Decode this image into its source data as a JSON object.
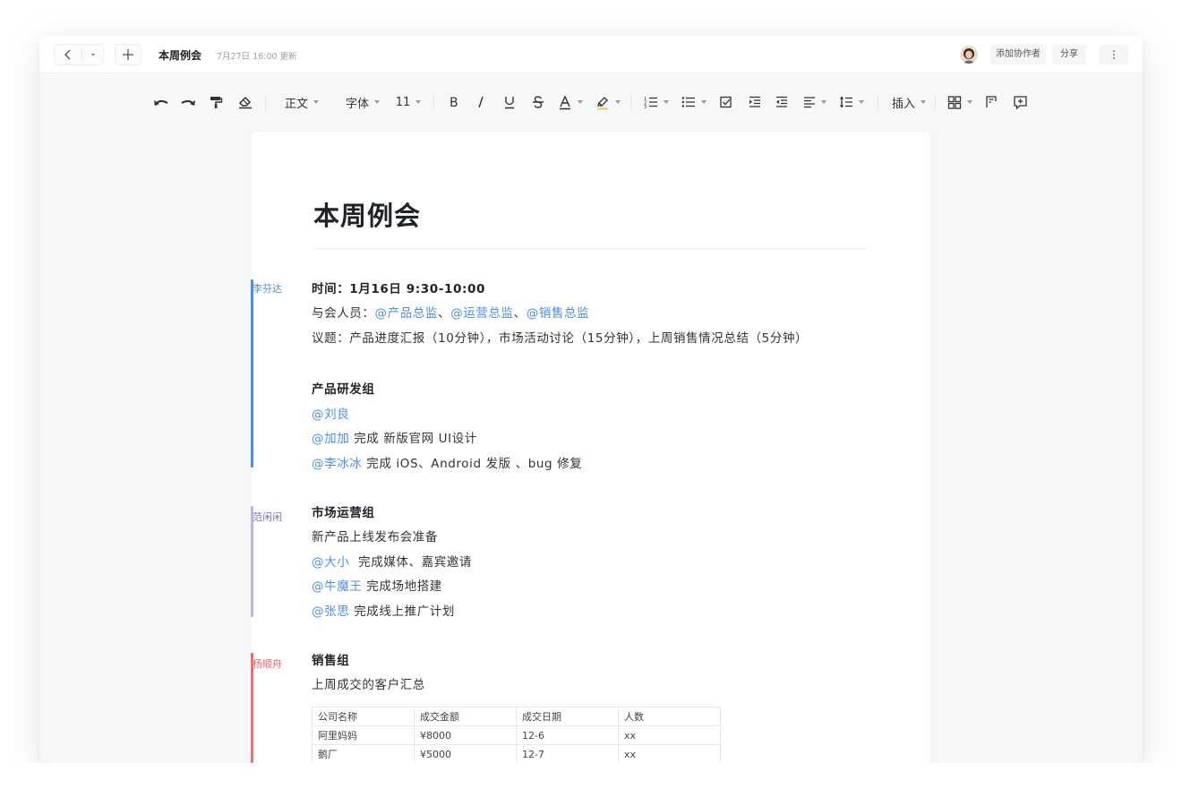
{
  "titlebar": {
    "doc_name": "本周例会",
    "update_time": "7月27日 16:00 更新",
    "add_collaborator": "添加协作者",
    "share": "分享"
  },
  "toolbar": {
    "style": "正文",
    "font": "字体",
    "size": "11",
    "insert": "插入",
    "icons": [
      "undo-icon",
      "redo-icon",
      "format-painter-icon",
      "eraser-icon",
      "bold-icon",
      "italic-icon",
      "underline-icon",
      "strikethrough-icon",
      "font-color-icon",
      "highlight-icon",
      "ordered-list-icon",
      "bullet-list-icon",
      "checkbox-icon",
      "indent-icon",
      "outdent-icon",
      "align-icon",
      "line-spacing-icon",
      "table-icon",
      "outline-icon",
      "comment-icon"
    ]
  },
  "doc": {
    "title": "本周例会",
    "meta": {
      "time": "时间：1月16日 9:30-10:00",
      "attendees_label": "与会人员：",
      "attendees": [
        "@产品总监",
        "@运营总监",
        "@销售总监"
      ],
      "attendees_sep": "、",
      "agenda": "议题：产品进度汇报（10分钟），市场活动讨论（15分钟），上周销售情况总结（5分钟）"
    },
    "product": {
      "heading": "产品研发组",
      "items": [
        {
          "mention": "@刘良",
          "text": ""
        },
        {
          "mention": "@加加",
          "text": " 完成 新版官网 UI设计"
        },
        {
          "mention": "@李冰冰",
          "text": " 完成 iOS、Android 发版 、bug 修复"
        }
      ]
    },
    "market": {
      "heading": "市场运营组",
      "intro": "新产品上线发布会准备",
      "items": [
        {
          "mention": "@大小",
          "text": "  完成媒体、嘉宾邀请"
        },
        {
          "mention": "@牛魔王",
          "text": " 完成场地搭建"
        },
        {
          "mention": "@张思",
          "text": " 完成线上推广计划"
        }
      ]
    },
    "sales": {
      "heading": "销售组",
      "intro": "上周成交的客户汇总",
      "table": {
        "headers": [
          "公司名称",
          "成交金额",
          "成交日期",
          "人数"
        ],
        "rows": [
          [
            "阿里妈妈",
            "¥8000",
            "12-6",
            "xx"
          ],
          [
            "鹅厂",
            "¥5000",
            "12-7",
            "xx"
          ]
        ]
      }
    }
  },
  "authors": [
    {
      "name": "李芬达",
      "color": "#4a90e2"
    },
    {
      "name": "范闲闲",
      "color": "#8c7cc9"
    },
    {
      "name": "杨顺舟",
      "color": "#e06666"
    }
  ]
}
